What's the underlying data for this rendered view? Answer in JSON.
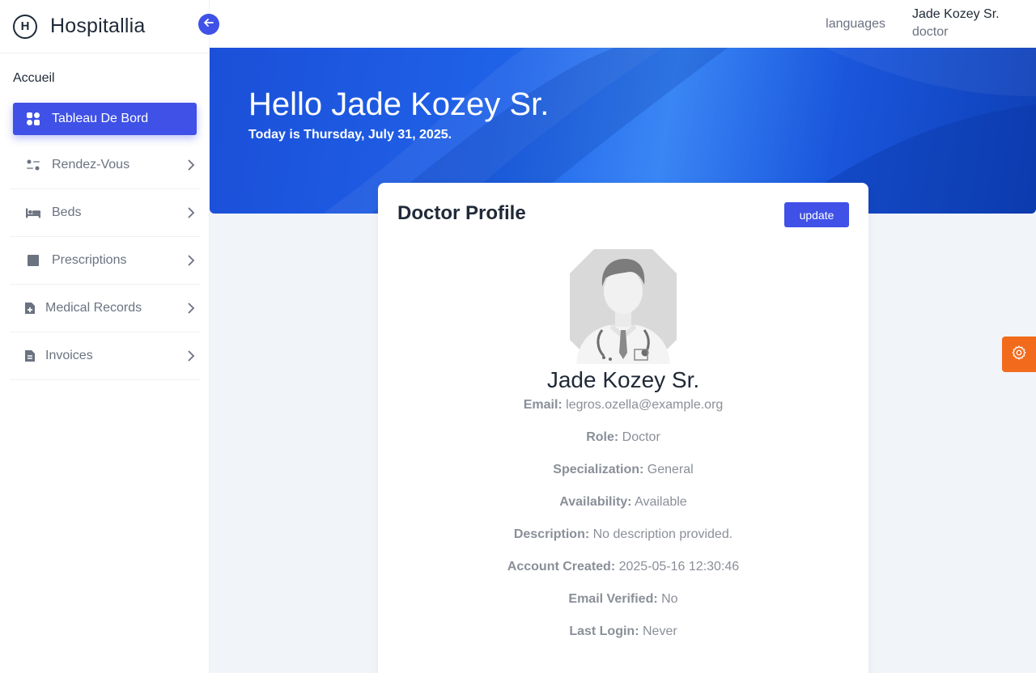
{
  "app": {
    "name": "Hospitallia",
    "logo_letter": "H"
  },
  "sidebar": {
    "section": "Accueil",
    "items": [
      {
        "label": "Tableau De Bord",
        "icon": "grid-icon",
        "active": true
      },
      {
        "label": "Rendez-Vous",
        "icon": "sliders-icon"
      },
      {
        "label": "Beds",
        "icon": "bed-icon"
      },
      {
        "label": "Prescriptions",
        "icon": "square-icon"
      },
      {
        "label": "Medical Records",
        "icon": "file-plus-icon"
      },
      {
        "label": "Invoices",
        "icon": "document-icon"
      }
    ]
  },
  "topbar": {
    "languages": "languages",
    "user_name": "Jade Kozey Sr.",
    "user_role": "doctor"
  },
  "hero": {
    "title": "Hello Jade Kozey Sr.",
    "subtitle": "Today is Thursday, July 31, 2025."
  },
  "profile": {
    "title": "Doctor Profile",
    "update_label": "update",
    "name": "Jade Kozey Sr.",
    "fields": [
      {
        "label": "Email:",
        "value": "legros.ozella@example.org"
      },
      {
        "label": "Role:",
        "value": "Doctor"
      },
      {
        "label": "Specialization:",
        "value": "General"
      },
      {
        "label": "Availability:",
        "value": "Available"
      },
      {
        "label": "Description:",
        "value": "No description provided."
      },
      {
        "label": "Account Created:",
        "value": "2025-05-16 12:30:46"
      },
      {
        "label": "Email Verified:",
        "value": "No"
      },
      {
        "label": "Last Login:",
        "value": "Never"
      }
    ]
  },
  "colors": {
    "primary": "#3f51e6",
    "accent": "#f26b1d",
    "hero": "#1f62e8"
  }
}
